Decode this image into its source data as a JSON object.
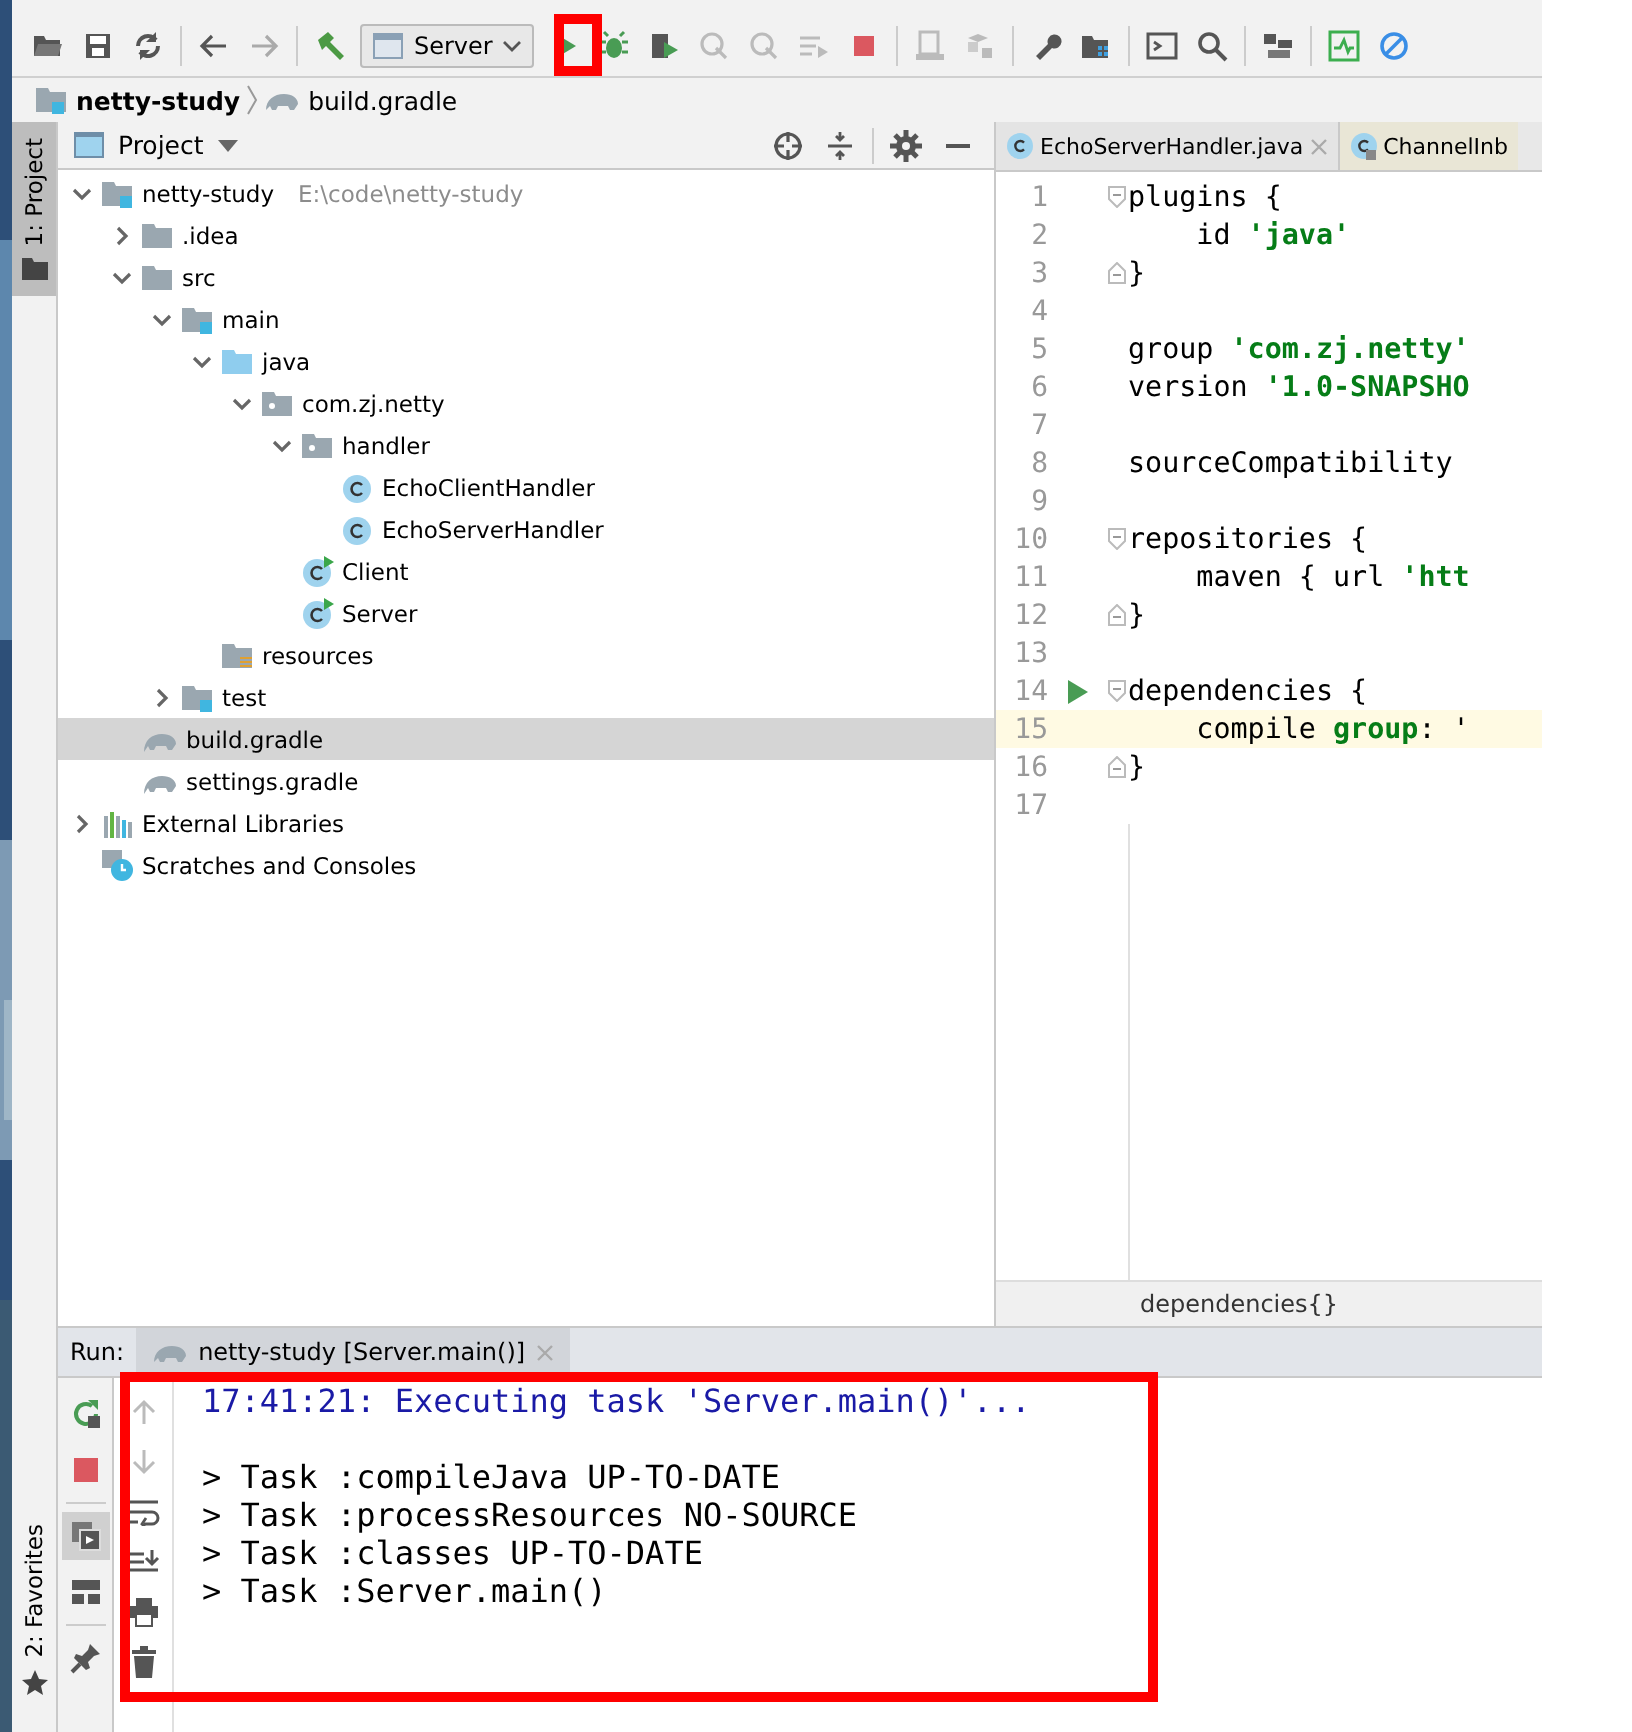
{
  "toolbar": {
    "run_config": "Server"
  },
  "breadcrumb": [
    "netty-study",
    "build.gradle"
  ],
  "side_tabs": {
    "top": "1: Project",
    "bottom": "2: Favorites"
  },
  "project_panel": {
    "title": "Project",
    "tree": [
      {
        "label": "netty-study",
        "kind": "module",
        "path": "E:\\code\\netty-study",
        "expanded": true,
        "selected": false,
        "children": [
          {
            "label": ".idea",
            "kind": "folder",
            "expanded": false,
            "selected": false
          },
          {
            "label": "src",
            "kind": "folder",
            "expanded": true,
            "selected": false,
            "children": [
              {
                "label": "main",
                "kind": "module-folder",
                "expanded": true,
                "selected": false,
                "children": [
                  {
                    "label": "java",
                    "kind": "source-folder",
                    "expanded": true,
                    "selected": false,
                    "children": [
                      {
                        "label": "com.zj.netty",
                        "kind": "package",
                        "expanded": true,
                        "selected": false,
                        "children": [
                          {
                            "label": "handler",
                            "kind": "package",
                            "expanded": true,
                            "selected": false,
                            "children": [
                              {
                                "label": "EchoClientHandler",
                                "kind": "class",
                                "selected": false
                              },
                              {
                                "label": "EchoServerHandler",
                                "kind": "class",
                                "selected": false
                              }
                            ]
                          },
                          {
                            "label": "Client",
                            "kind": "main-class",
                            "selected": false
                          },
                          {
                            "label": "Server",
                            "kind": "main-class",
                            "selected": false
                          }
                        ]
                      }
                    ]
                  },
                  {
                    "label": "resources",
                    "kind": "resources-folder",
                    "selected": false
                  }
                ]
              },
              {
                "label": "test",
                "kind": "module-folder",
                "expanded": false,
                "selected": false
              }
            ]
          },
          {
            "label": "build.gradle",
            "kind": "gradle",
            "selected": true
          },
          {
            "label": "settings.gradle",
            "kind": "gradle",
            "selected": false
          }
        ]
      },
      {
        "label": "External Libraries",
        "kind": "libraries",
        "expanded": false,
        "selected": false
      },
      {
        "label": "Scratches and Consoles",
        "kind": "scratches",
        "selected": false
      }
    ]
  },
  "editor": {
    "tabs": [
      {
        "label": "EchoServerHandler.java",
        "kind": "project",
        "closable": true
      },
      {
        "label": "ChannelInb",
        "kind": "library",
        "closable": false
      }
    ],
    "lines": [
      {
        "number": "1",
        "current": false,
        "fold_start": true,
        "tokens": [
          {
            "text": "plugins {",
            "kind": "plain"
          }
        ]
      },
      {
        "number": "2",
        "current": false,
        "tokens": [
          {
            "text": "    id ",
            "kind": "plain"
          },
          {
            "text": "'java'",
            "kind": "string"
          }
        ]
      },
      {
        "number": "3",
        "current": false,
        "fold_end": true,
        "tokens": [
          {
            "text": "}",
            "kind": "plain"
          }
        ]
      },
      {
        "number": "4",
        "current": false
      },
      {
        "number": "5",
        "current": false,
        "tokens": [
          {
            "text": "group ",
            "kind": "plain"
          },
          {
            "text": "'com.zj.netty'",
            "kind": "string"
          }
        ]
      },
      {
        "number": "6",
        "current": false,
        "tokens": [
          {
            "text": "version ",
            "kind": "plain"
          },
          {
            "text": "'1.0-SNAPSHO",
            "kind": "string"
          }
        ]
      },
      {
        "number": "7",
        "current": false
      },
      {
        "number": "8",
        "current": false,
        "tokens": [
          {
            "text": "sourceCompatibility",
            "kind": "plain"
          }
        ]
      },
      {
        "number": "9",
        "current": false
      },
      {
        "number": "10",
        "current": false,
        "fold_start": true,
        "tokens": [
          {
            "text": "repositories {",
            "kind": "plain"
          }
        ]
      },
      {
        "number": "11",
        "current": false,
        "tokens": [
          {
            "text": "    maven { url ",
            "kind": "plain"
          },
          {
            "text": "'htt",
            "kind": "string"
          }
        ]
      },
      {
        "number": "12",
        "current": false,
        "fold_end": true,
        "tokens": [
          {
            "text": "}",
            "kind": "plain"
          }
        ]
      },
      {
        "number": "13",
        "current": false
      },
      {
        "number": "14",
        "current": false,
        "fold_start": true,
        "run_marker": true,
        "tokens": [
          {
            "text": "dependencies {",
            "kind": "plain"
          }
        ]
      },
      {
        "number": "15",
        "current": true,
        "tokens": [
          {
            "text": "    compile ",
            "kind": "plain"
          },
          {
            "text": "group",
            "kind": "keyword"
          },
          {
            "text": ": '",
            "kind": "plain"
          }
        ]
      },
      {
        "number": "16",
        "current": false,
        "fold_end": true,
        "tokens": [
          {
            "text": "}",
            "kind": "plain"
          }
        ]
      },
      {
        "number": "17",
        "current": false
      }
    ],
    "breadcrumb": "dependencies{}"
  },
  "run_panel": {
    "label": "Run:",
    "tab": "netty-study [Server.main()]",
    "console": [
      {
        "kind": "info",
        "text": "17:41:21: Executing task 'Server.main()'..."
      },
      {
        "kind": "blank"
      },
      {
        "kind": "output",
        "text": "> Task :compileJava UP-TO-DATE"
      },
      {
        "kind": "output",
        "text": "> Task :processResources NO-SOURCE"
      },
      {
        "kind": "output",
        "text": "> Task :classes UP-TO-DATE"
      },
      {
        "kind": "output",
        "text": "> Task :Server.main()"
      }
    ]
  }
}
